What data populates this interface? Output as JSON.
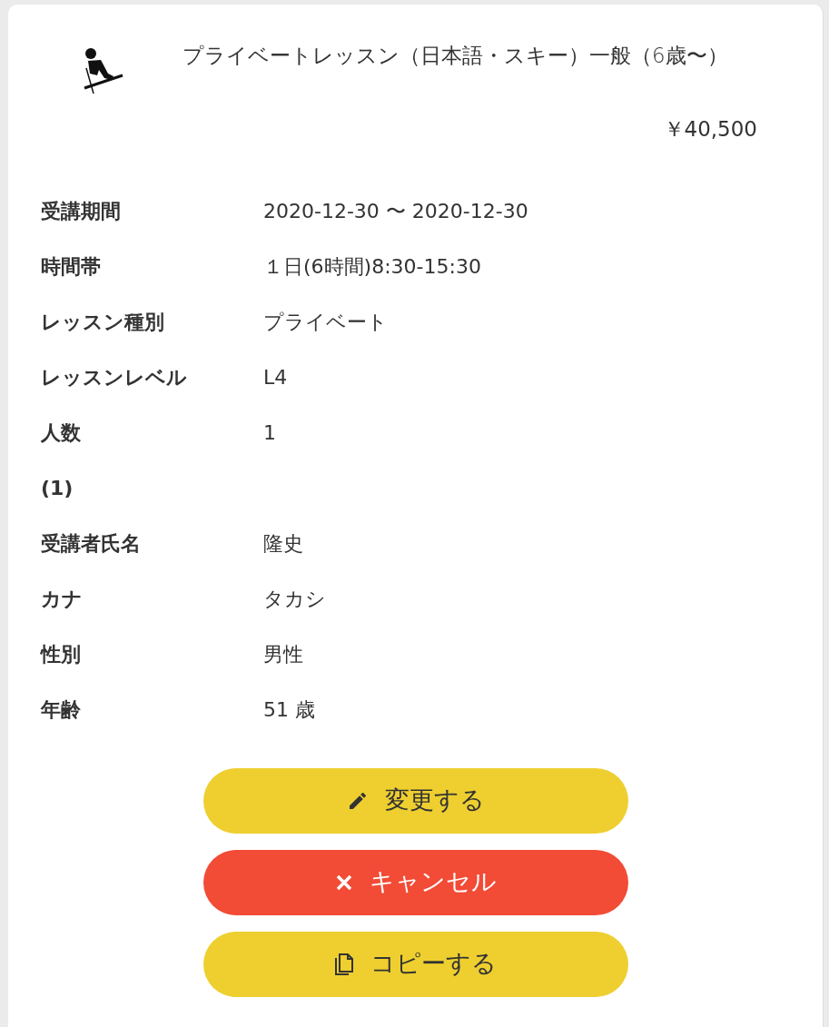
{
  "lesson": {
    "title": "プライベートレッスン（日本語・スキー）一般（6歳〜）",
    "price": "￥40,500"
  },
  "details": [
    {
      "label": "受講期間",
      "value": "2020-12-30 〜 2020-12-30"
    },
    {
      "label": "時間帯",
      "value": "１日(6時間)8:30-15:30"
    },
    {
      "label": "レッスン種別",
      "value": "プライベート"
    },
    {
      "label": "レッスンレベル",
      "value": "L4"
    },
    {
      "label": "人数",
      "value": "1"
    },
    {
      "label": "(1)"
    },
    {
      "label": "受講者氏名",
      "value": "隆史"
    },
    {
      "label": "カナ",
      "value": "タカシ"
    },
    {
      "label": "性別",
      "value": "男性"
    },
    {
      "label": "年齢",
      "value": "51 歳"
    }
  ],
  "buttons": [
    {
      "kind": "edit",
      "label": "変更する"
    },
    {
      "kind": "cancel",
      "label": "キャンセル"
    },
    {
      "kind": "copy",
      "label": "コピーする"
    }
  ]
}
